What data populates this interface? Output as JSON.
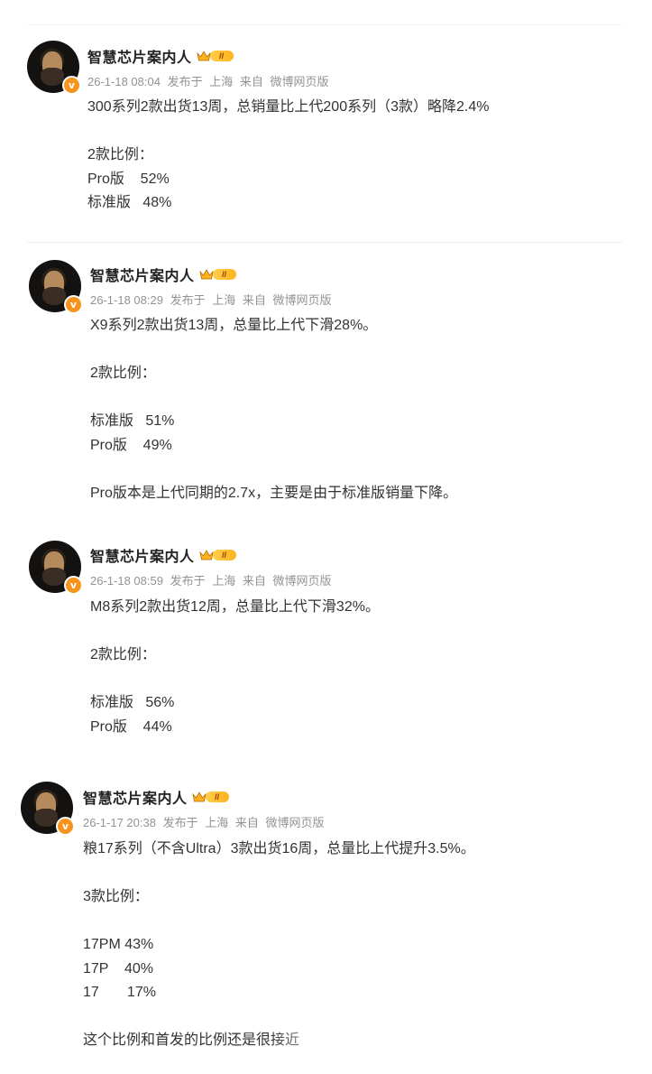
{
  "posts": [
    {
      "username": "智慧芯片案内人",
      "level": "II",
      "time": "26-1-18 08:04",
      "published": "发布于",
      "location": "上海",
      "from_label": "来自",
      "source": "微博网页版",
      "lines": [
        "300系列2款出货13周，总销量比上代200系列（3款）略降2.4%",
        "",
        "2款比例：",
        "Pro版    52%",
        "标准版   48%"
      ]
    },
    {
      "username": "智慧芯片案内人",
      "level": "II",
      "time": "26-1-18 08:29",
      "published": "发布于",
      "location": "上海",
      "from_label": "来自",
      "source": "微博网页版",
      "lines": [
        "X9系列2款出货13周，总量比上代下滑28%。",
        "",
        "2款比例：",
        "",
        "标准版   51%",
        "Pro版    49%",
        "",
        "Pro版本是上代同期的2.7x，主要是由于标准版销量下降。"
      ]
    },
    {
      "username": "智慧芯片案内人",
      "level": "II",
      "time": "26-1-18 08:59",
      "published": "发布于",
      "location": "上海",
      "from_label": "来自",
      "source": "微博网页版",
      "lines": [
        "M8系列2款出货12周，总量比上代下滑32%。",
        "",
        "2款比例：",
        "",
        "标准版   56%",
        "Pro版    44%"
      ]
    },
    {
      "username": "智慧芯片案内人",
      "level": "II",
      "time": "26-1-17 20:38",
      "published": "发布于",
      "location": "上海",
      "from_label": "来自",
      "source": "微博网页版",
      "lines": [
        "粮17系列（不含Ultra）3款出货16周，总量比上代提升3.5%。",
        "",
        "3款比例：",
        "",
        "17PM 43%",
        "17P    40%",
        "17       17%",
        "",
        "这个比例和首发的比例还是很接近"
      ]
    }
  ],
  "icons": {
    "verified": "v-badge-icon",
    "crown": "crown-icon"
  },
  "colors": {
    "verified_badge": "#f7941d",
    "level_badge": "#ffbf2e",
    "meta_text": "#939393",
    "body_text": "#333333"
  }
}
